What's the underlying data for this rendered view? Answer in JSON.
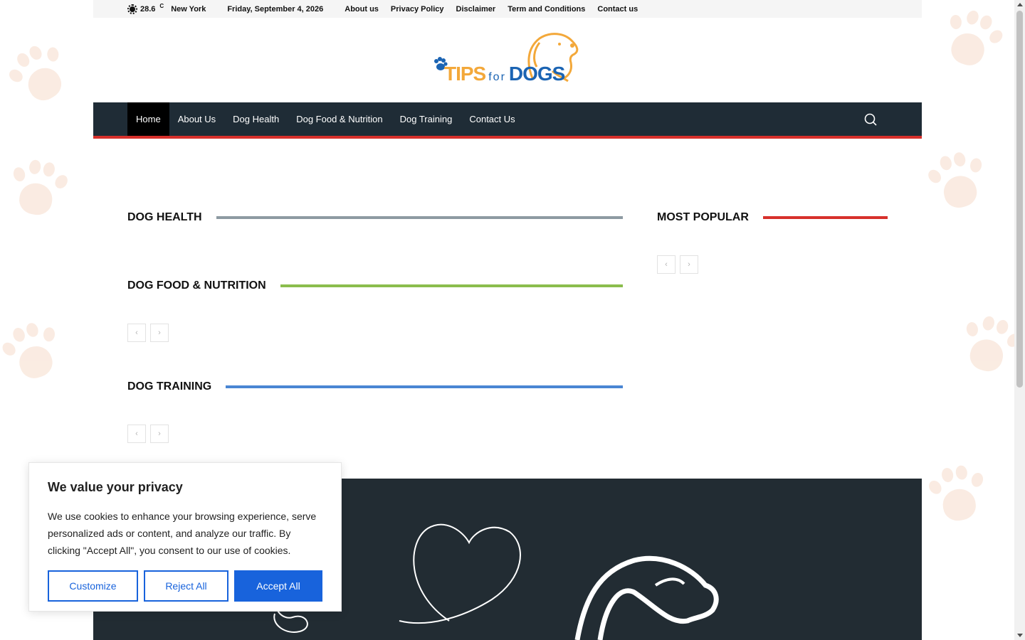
{
  "topbar": {
    "temperature": "28.6",
    "unit": "C",
    "city": "New York",
    "date": "Friday, September 4, 2026",
    "links": [
      "About us",
      "Privacy Policy",
      "Disclaimer",
      "Term and Conditions",
      "Contact us"
    ]
  },
  "logo": {
    "word1": "TIPS",
    "word2": "for",
    "word3": "DOGS"
  },
  "nav": {
    "items": [
      "Home",
      "About Us",
      "Dog Health",
      "Dog Food & Nutrition",
      "Dog Training",
      "Contact Us"
    ],
    "active": "Home",
    "search_icon": "search-icon"
  },
  "sections": {
    "dog_health": {
      "title": "DOG HEALTH",
      "color": "#8d9aa2"
    },
    "dog_food": {
      "title": "DOG FOOD & NUTRITION",
      "color": "#8bbd4d"
    },
    "dog_training": {
      "title": "DOG TRAINING",
      "color": "#4a86d3"
    },
    "most_popular": {
      "title": "MOST POPULAR",
      "color": "#d7302b"
    }
  },
  "pager": {
    "prev": "‹",
    "next": "›"
  },
  "cookie": {
    "title": "We value your privacy",
    "text": "We use cookies to enhance your browsing experience, serve personalized ads or content, and analyze our traffic. By clicking \"Accept All\", you consent to our use of cookies.",
    "customize": "Customize",
    "reject": "Reject All",
    "accept": "Accept All"
  },
  "colors": {
    "nav_bg": "#1f2c36",
    "nav_accent": "#d7302b",
    "footer_bg": "#222c33",
    "cookie_accent": "#1863dc",
    "logo_orange": "#f3a83a",
    "logo_blue": "#1b64b3"
  }
}
